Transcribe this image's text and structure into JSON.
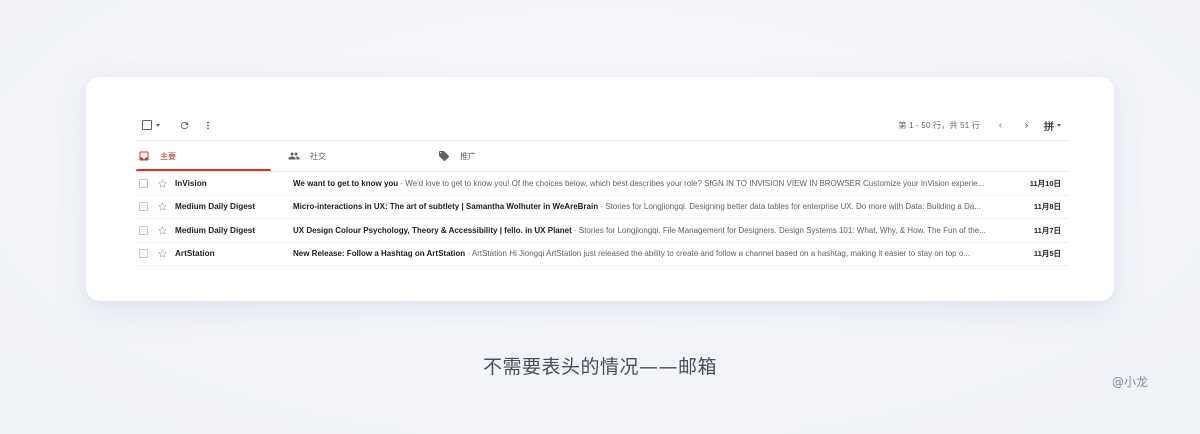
{
  "toolbar": {
    "pagination_text": "第 1 - 50 行，共 51 行",
    "lang_label": "拼"
  },
  "tabs": [
    {
      "label": "主要",
      "icon": "inbox-icon",
      "active": true
    },
    {
      "label": "社交",
      "icon": "people-icon",
      "active": false
    },
    {
      "label": "推广",
      "icon": "tag-icon",
      "active": false
    }
  ],
  "emails": [
    {
      "sender": "InVision",
      "subject": "We want to get to know you",
      "separator": " - ",
      "snippet": "We'd love to get to know you! Of the choices below, which best describes your role? SIGN IN TO INVISION VIEW IN BROWSER Customize your InVision experie...",
      "date": "11月10日"
    },
    {
      "sender": "Medium Daily Digest",
      "subject": "Micro-interactions in UX: The art of subtlety | Samantha Wolhuter in WeAreBrain",
      "separator": " - ",
      "snippet": "Stories for Longjiongqi. Designing better data tables for enterprise UX. Do more with Data: Building a Da...",
      "date": "11月8日"
    },
    {
      "sender": "Medium Daily Digest",
      "subject": "UX Design Colour Psychology, Theory & Accessibility | fello. in UX Planet",
      "separator": " - ",
      "snippet": "Stories for Longjiongqi. File Management for Designers. Design Systems 101: What, Why, & How. The Fun of the...",
      "date": "11月7日"
    },
    {
      "sender": "ArtStation",
      "subject": "New Release: Follow a Hashtag on ArtStation",
      "separator": " - ",
      "snippet": "ArtStation Hi Jiongqi ArtStation just released the ability to create and follow a channel based on a hashtag, making it easier to stay on top o...",
      "date": "11月5日"
    }
  ],
  "caption": "不需要表头的情况——邮箱",
  "author": "@小龙",
  "colors": {
    "accent": "#d93025",
    "text_primary": "#202124",
    "text_secondary": "#5f6368"
  }
}
